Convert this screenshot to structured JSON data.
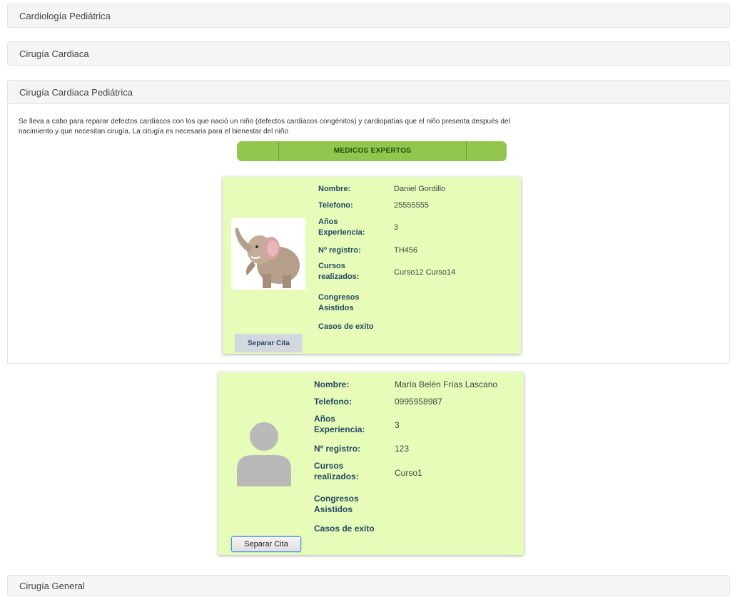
{
  "specialties": {
    "cardiologia_pediatrica": "Cardiología Pediátrica",
    "cirugia_cardiaca": "Cirugía Cardiaca",
    "cirugia_cardiaca_pediatrica": "Cirugía Cardiaca Pediátrica",
    "cirugia_general": "Cirugía General"
  },
  "description": {
    "line1": "Se lleva a cabo para reparar defectos cardíacos con los que nació un niño (defectos cardíacos congénitos) y cardiopatías que el niño presenta después del",
    "line2": "nacimiento y que necesitan cirugía. La cirugía es necesaria para el bienestar del niño"
  },
  "experts_title": "MEDICOS EXPERTOS",
  "labels": {
    "nombre": "Nombre:",
    "telefono": "Telefono:",
    "anos_line1": "Años",
    "anos_line2": "Experiencia:",
    "registro": "Nº registro:",
    "cursos_line1": "Cursos",
    "cursos_line2": "realizados:",
    "congresos_line1": "Congresos",
    "congresos_line2": "Asistidos",
    "casos": "Casos de exito"
  },
  "doctors": [
    {
      "nombre": "Daniel Gordillo",
      "telefono": "25555555",
      "anos": "3",
      "registro": "TH456",
      "cursos": "Curso12 Curso14",
      "photo_icon": "elephant-photo",
      "button": "Separar Cita"
    },
    {
      "nombre": "María Belén Frías Lascano",
      "telefono": "0995958987",
      "anos": "3",
      "registro": "123",
      "cursos": "Curso1",
      "photo_icon": "user-avatar-icon",
      "button": "Separar Cita"
    }
  ],
  "colors": {
    "card_bg": "#e6fcb8",
    "experts_bar": "#92c64f",
    "panel_heading": "#f5f5f5"
  }
}
